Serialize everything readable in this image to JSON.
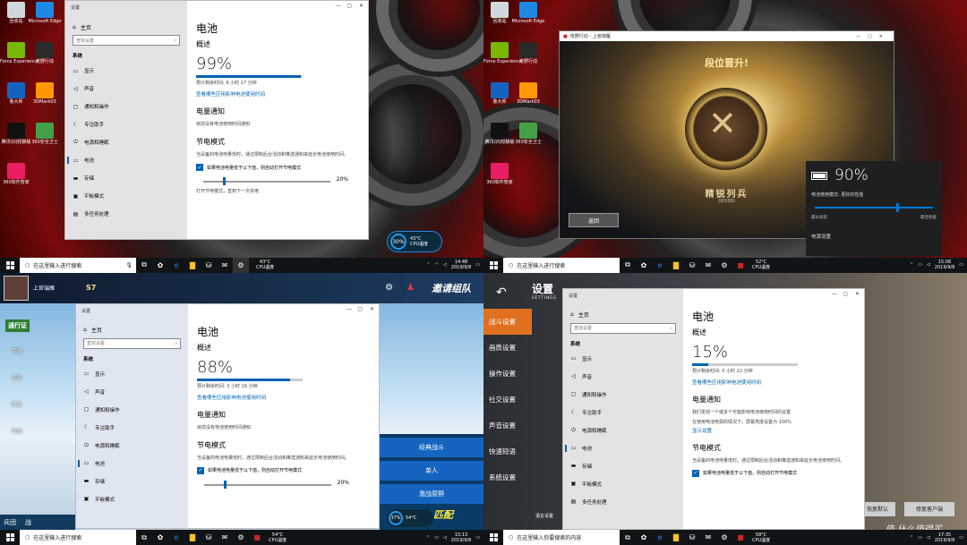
{
  "q1": {
    "desktop": [
      {
        "label": "回收站",
        "color": "#cfd8dc"
      },
      {
        "label": "Microsoft Edge",
        "color": "#1e88e5"
      },
      {
        "label": "GeForce Experience",
        "color": "#76b900"
      },
      {
        "label": "荒野行动",
        "color": "#2a2a2a"
      },
      {
        "label": "鲁大师",
        "color": "#1565c0"
      },
      {
        "label": "3DMark03",
        "color": "#ff9800"
      },
      {
        "label": "腾讯QQ轻聊版",
        "color": "#111"
      },
      {
        "label": "360安全卫士",
        "color": "#43a047"
      },
      {
        "label": "360软件管家",
        "color": "#e91e63"
      }
    ],
    "window_title": "设置",
    "home": "主页",
    "search": "查找设置",
    "category": "系统",
    "nav": [
      {
        "icon": "▭",
        "label": "显示"
      },
      {
        "icon": "◁",
        "label": "声音"
      },
      {
        "icon": "▢",
        "label": "通知和操作"
      },
      {
        "icon": "☾",
        "label": "专注助手"
      },
      {
        "icon": "⏻",
        "label": "电源和睡眠"
      },
      {
        "icon": "▭",
        "label": "电池",
        "active": true
      },
      {
        "icon": "▬",
        "label": "存储"
      },
      {
        "icon": "▣",
        "label": "平板模式"
      },
      {
        "icon": "▤",
        "label": "多任务处理"
      }
    ],
    "title": "电池",
    "overview": "概述",
    "percent": "99%",
    "fill": 0.99,
    "remaining": "预计剩余时间: 9 小时 17 分钟",
    "app_link": "查看哪些应用影响电池使用时间",
    "notice_title": "电量通知",
    "notice_text": "目前没有电池使用时间通知",
    "saver_title": "节电模式",
    "saver_text": "当设备的电池电量低时，通过限制后台活动和推送通知来延长电池使用时间。",
    "checkbox": "如果电池电量低于以下值，则自动打开节电模式",
    "slider_value": "20%",
    "tail": "打开节电模式，直到下一次充电",
    "gauge": "30%",
    "gauge_temp": "43°C",
    "gauge_sub": "CPU温度",
    "search_box": "在这里输入进行搜索",
    "cpu": "43°C",
    "cpu_sub": "CPU温度",
    "time": "14:48",
    "date": "2019/9/8"
  },
  "q2": {
    "desktop": [
      {
        "label": "回收站",
        "color": "#cfd8dc"
      },
      {
        "label": "Microsoft Edge",
        "color": "#1e88e5"
      },
      {
        "label": "GeForce Experience",
        "color": "#76b900"
      },
      {
        "label": "荒野行动",
        "color": "#2a2a2a"
      },
      {
        "label": "鲁大师",
        "color": "#1565c0"
      },
      {
        "label": "3DMark03",
        "color": "#ff9800"
      },
      {
        "label": "腾讯QQ轻聊版",
        "color": "#111"
      },
      {
        "label": "360安全卫士",
        "color": "#43a047"
      },
      {
        "label": "360软件管家",
        "color": "#e91e63"
      }
    ],
    "game_title": "荒野行动 - 上官瑞雁",
    "rank_up": "段位晋升!",
    "rank_name": "精锐列兵",
    "rank_score": "(9/100)",
    "back": "返回",
    "battery": "90%",
    "mode_label": "电池使用模式: 更好的性能",
    "best_battery": "最长续航",
    "best_perf": "最佳性能",
    "power_settings": "电源设置",
    "search_box": "在这里输入进行搜索",
    "cpu": "52°C",
    "cpu_sub": "CPU温度",
    "time": "15:08",
    "date": "2019/9/8"
  },
  "q3": {
    "username": "上官瑞雁",
    "level": "S7",
    "team": "邀请组队",
    "pass": "通行证",
    "side_labels": [
      "商城",
      "任务",
      "好友",
      "背包"
    ],
    "bottom_tabs": [
      "兵团",
      "战"
    ],
    "mode_right": [
      "经典战斗",
      "单人",
      "激战原野"
    ],
    "match": "匹配",
    "gauge": "37%",
    "gauge_temp": "54°C",
    "window_title": "设置",
    "home": "主页",
    "search": "查找设置",
    "category": "系统",
    "nav": [
      {
        "icon": "▭",
        "label": "显示"
      },
      {
        "icon": "◁",
        "label": "声音"
      },
      {
        "icon": "▢",
        "label": "通知和操作"
      },
      {
        "icon": "☾",
        "label": "专注助手"
      },
      {
        "icon": "⏻",
        "label": "电源和睡眠"
      },
      {
        "icon": "▭",
        "label": "电池",
        "active": true
      },
      {
        "icon": "▬",
        "label": "存储"
      },
      {
        "icon": "▣",
        "label": "平板模式"
      }
    ],
    "title": "电池",
    "overview": "概述",
    "percent": "88%",
    "fill": 0.88,
    "remaining": "预计剩余时间: 3 小时 16 分钟",
    "app_link": "查看哪些应用影响电池使用时间",
    "notice_title": "电量通知",
    "notice_text": "目前没有电池使用时间通知",
    "saver_title": "节电模式",
    "saver_text": "当设备的电池电量低时，通过限制后台活动和推送通知来延长电池使用时间。",
    "checkbox": "如果电池电量低于以下值，则自动打开节电模式",
    "slider_value": "20%",
    "search_box": "在这里输入进行搜索",
    "cpu": "54°C",
    "cpu_sub": "CPU温度",
    "time": "15:13",
    "date": "2019/9/8"
  },
  "q4": {
    "game_header": "设置",
    "game_header_en": "SETTINGS",
    "game_menu": [
      "战斗设置",
      "画质设置",
      "操作设置",
      "社交设置",
      "声音设置",
      "快速短语",
      "系统设置"
    ],
    "lang": "语言设置",
    "restore": "恢复默认",
    "repair": "修复客户端",
    "window_title": "设置",
    "home": "主页",
    "search": "查找设置",
    "category": "系统",
    "nav": [
      {
        "icon": "▭",
        "label": "显示"
      },
      {
        "icon": "◁",
        "label": "声音"
      },
      {
        "icon": "▢",
        "label": "通知和操作"
      },
      {
        "icon": "☾",
        "label": "专注助手"
      },
      {
        "icon": "⏻",
        "label": "电源和睡眠"
      },
      {
        "icon": "▭",
        "label": "电池",
        "active": true
      },
      {
        "icon": "▬",
        "label": "存储"
      },
      {
        "icon": "▣",
        "label": "平板模式"
      },
      {
        "icon": "▤",
        "label": "多任务处理"
      }
    ],
    "title": "电池",
    "overview": "概述",
    "percent": "15%",
    "fill": 0.15,
    "remaining": "预计剩余时间: 0 小时 22 分钟",
    "app_link": "查看哪些应用影响电池使用时间",
    "notice_title": "电量通知",
    "notice_text": "我们发现一个或多个可能影响电池使用时间的设置",
    "notice_text2": "在使用电池电源的情况下，屏幕亮度设置为 100%",
    "notice_link": "显示设置",
    "saver_title": "节电模式",
    "saver_text": "当设备的电池电量低时，通过限制后台活动和推送通知来延长电池使用时间。",
    "checkbox": "如果电池电量低于以下值，则自动打开节电模式",
    "search_box": "在这里输入你要搜索的内容",
    "cpu": "58°C",
    "cpu_sub": "CPU温度",
    "time": "17:35",
    "date": "2019/9/8",
    "watermark": "值 什么值得买"
  }
}
